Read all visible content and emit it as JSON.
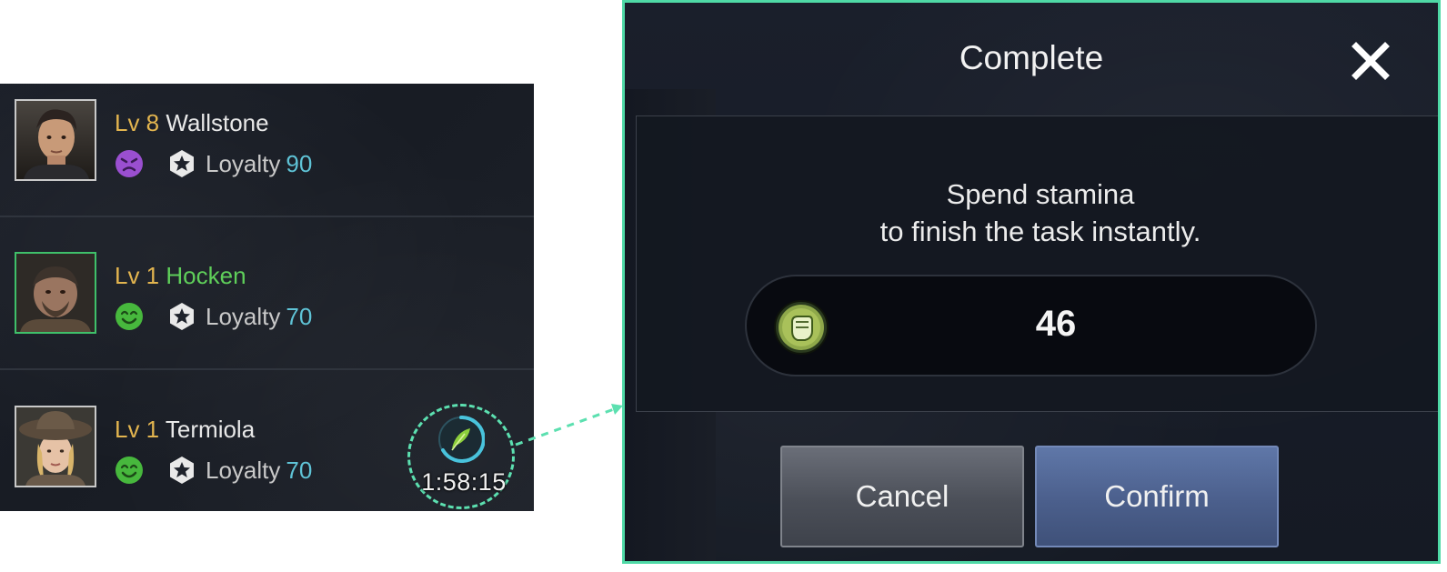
{
  "roster": {
    "rows": [
      {
        "level": "Lv 8",
        "name": "Wallstone",
        "name_color": "#e8e8e8",
        "mood": "angry-face-icon",
        "mood_color": "#9a4fd0",
        "loyalty_label": "Loyalty",
        "loyalty_value": "90"
      },
      {
        "level": "Lv 1",
        "name": "Hocken",
        "name_color": "#5fcf5a",
        "mood": "happy-face-icon",
        "mood_color": "#47b83d",
        "loyalty_label": "Loyalty",
        "loyalty_value": "70"
      },
      {
        "level": "Lv 1",
        "name": "Termiola",
        "name_color": "#e8e8e8",
        "mood": "happy-face-icon",
        "mood_color": "#47b83d",
        "loyalty_label": "Loyalty",
        "loyalty_value": "70"
      }
    ],
    "task_timer": {
      "icon": "feather-icon",
      "time": "1:58:15"
    }
  },
  "dialog": {
    "title": "Complete",
    "close_icon": "close-icon",
    "message_line1": "Spend stamina",
    "message_line2": "to finish the task instantly.",
    "cost_icon": "stamina-fist-icon",
    "cost_value": "46",
    "cancel_label": "Cancel",
    "confirm_label": "Confirm"
  },
  "colors": {
    "level": "#e3b54f",
    "loyalty_value": "#5fc3d6",
    "highlight": "#4fd9a6",
    "confirm_button": "#4b5f8c",
    "cancel_button": "#4b4f58"
  }
}
